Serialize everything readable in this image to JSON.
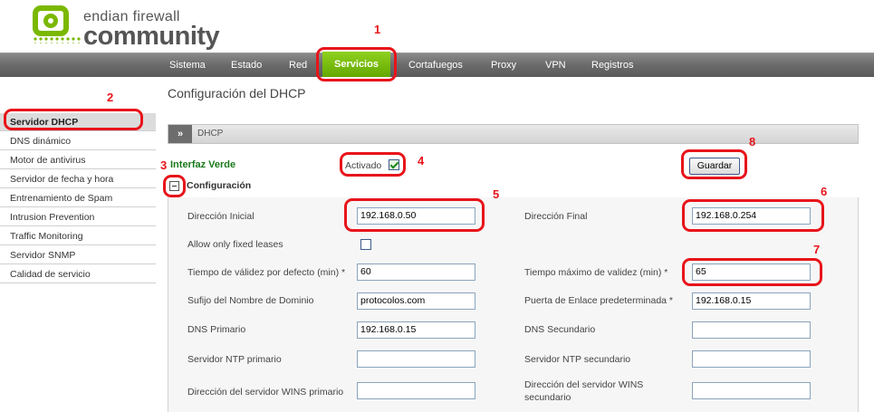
{
  "logo": {
    "line1": "endian firewall",
    "line2": "community"
  },
  "nav": {
    "items": [
      "Sistema",
      "Estado",
      "Red",
      "Servicios",
      "Cortafuegos",
      "Proxy",
      "VPN",
      "Registros"
    ],
    "active": "Servicios"
  },
  "sidebar": {
    "items": [
      "Servidor DHCP",
      "DNS dinámico",
      "Motor de antivirus",
      "Servidor de fecha y hora",
      "Entrenamiento de Spam",
      "Intrusion Prevention",
      "Traffic Monitoring",
      "Servidor SNMP",
      "Calidad de servicio"
    ],
    "active": "Servidor DHCP"
  },
  "page": {
    "title": "Configuración del DHCP"
  },
  "section": {
    "toggle": "»",
    "title": "DHCP"
  },
  "interface": {
    "label": "Interfaz Verde",
    "enabled_label": "Activado",
    "enabled": true,
    "save_label": "Guardar"
  },
  "config": {
    "title": "Configuración",
    "fields": {
      "start_label": "Dirección Inicial",
      "start_value": "192.168.0.50",
      "end_label": "Dirección Final",
      "end_value": "192.168.0.254",
      "fixed_label": "Allow only fixed leases",
      "fixed_checked": false,
      "default_lease_label": "Tiempo de válidez por defecto (min) *",
      "default_lease_value": "60",
      "max_lease_label": "Tiempo máximo de validez (min) *",
      "max_lease_value": "65",
      "domain_label": "Sufijo del Nombre de Dominio",
      "domain_value": "protocolos.com",
      "gateway_label": "Puerta de Enlace predeterminada *",
      "gateway_value": "192.168.0.15",
      "dns1_label": "DNS Primario",
      "dns1_value": "192.168.0.15",
      "dns2_label": "DNS Secundario",
      "dns2_value": "",
      "ntp1_label": "Servidor NTP primario",
      "ntp1_value": "",
      "ntp2_label": "Servidor NTP secundario",
      "ntp2_value": "",
      "wins1_label": "Dirección del servidor WINS primario",
      "wins1_value": "",
      "wins2_label_1": "Dirección del servidor WINS",
      "wins2_label_2": "secundario",
      "wins2_value": ""
    }
  },
  "annotations": [
    "1",
    "2",
    "3",
    "4",
    "5",
    "6",
    "7",
    "8"
  ],
  "colors": {
    "annotation": "#e8141a",
    "accent_green": "#7ab800",
    "nav_bg": "#6a6a6a"
  }
}
